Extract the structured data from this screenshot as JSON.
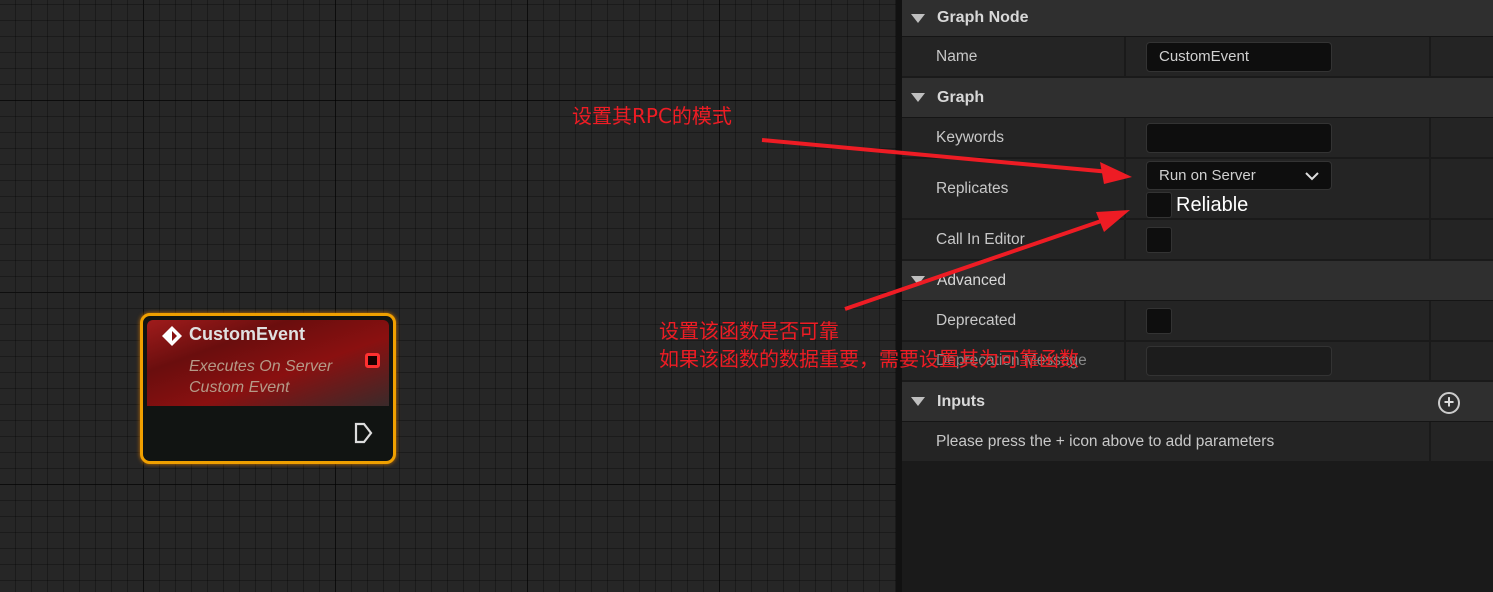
{
  "node": {
    "title": "CustomEvent",
    "subtitle_line1": "Executes On Server",
    "subtitle_line2": "Custom Event",
    "header_color": "#8a1010",
    "border_color": "#f0a000"
  },
  "panel": {
    "graph_node": {
      "header": "Graph Node",
      "name_label": "Name",
      "name_value": "CustomEvent"
    },
    "graph": {
      "header": "Graph",
      "keywords_label": "Keywords",
      "keywords_value": "",
      "replicates_label": "Replicates",
      "replicates_value": "Run on Server",
      "reliable_label": "Reliable",
      "reliable_checked": false,
      "call_in_editor_label": "Call In Editor",
      "call_in_editor_checked": false
    },
    "advanced": {
      "header": "Advanced",
      "deprecated_label": "Deprecated",
      "deprecated_checked": false,
      "deprecation_message_label": "Deprecation Message",
      "deprecation_message_value": ""
    },
    "inputs": {
      "header": "Inputs",
      "hint": "Please press the + icon above to add parameters",
      "add_icon": "plus-circle-icon"
    }
  },
  "annotations": {
    "rpc_mode": "设置其RPC的模式",
    "reliable_line1": "设置该函数是否可靠",
    "reliable_line2": "如果该函数的数据重要，需要设置其为可靠函数",
    "color": "#ee1c24"
  }
}
